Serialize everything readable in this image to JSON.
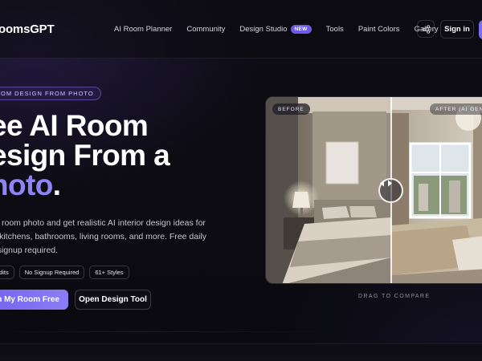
{
  "brand": {
    "name": "oomsGPT"
  },
  "nav": {
    "links": [
      "AI Room Planner",
      "Community",
      "Design Studio",
      "Tools",
      "Paint Colors",
      "Gallery"
    ],
    "new_badge": "NEW",
    "signin_label": "Sign in"
  },
  "hero": {
    "eyebrow": "OM DESIGN FROM PHOTO",
    "headline_line1": "ee AI Room",
    "headline_line2": "esign From a",
    "headline_accent": "hoto",
    "headline_end": ".",
    "subtext_line1": "ny room photo and get realistic AI interior design ideas for",
    "subtext_line2": "s, kitchens, bathrooms, living rooms, and more. Free daily",
    "subtext_line3": "o signup required.",
    "chips": [
      "Credits",
      "No Signup Required",
      "61+ Styles"
    ],
    "cta_primary": "gn My Room Free",
    "cta_secondary": "Open Design Tool"
  },
  "compare": {
    "before_label": "BEFORE",
    "after_label": "AFTER (AI GENE",
    "caption": "DRAG TO COMPARE"
  },
  "colors": {
    "accent": "#8f84f5",
    "button": "#7262ee",
    "background": "#0b0a10"
  },
  "icons": {
    "share": "share-icon",
    "handle": "arrows-left-right-icon"
  }
}
